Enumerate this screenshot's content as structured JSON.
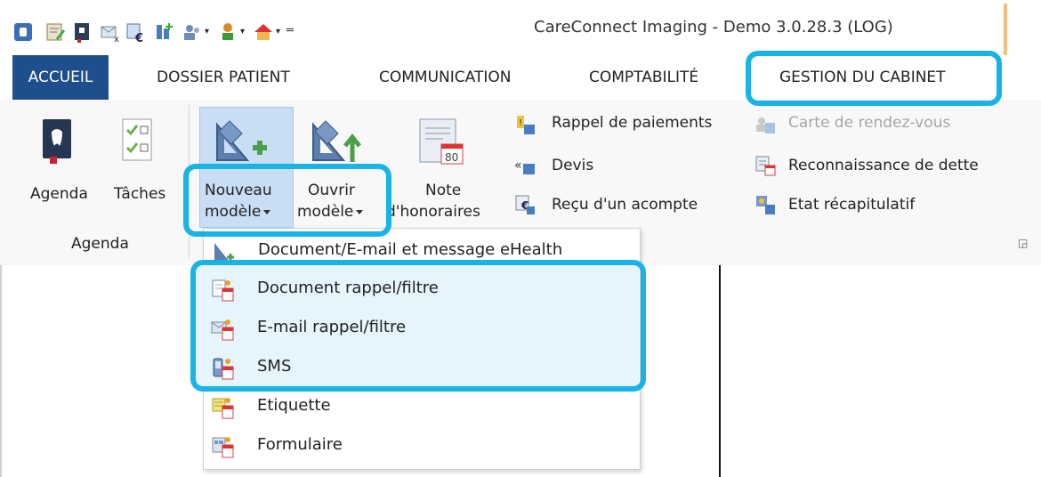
{
  "window": {
    "title": "CareConnect Imaging - Demo 3.0.28.3 (LOG)"
  },
  "quick_access": {
    "icons": [
      "app-icon",
      "patient-edit-icon",
      "agenda-book-icon",
      "mail-x-icon",
      "euro-invoice-icon",
      "print-icon",
      "users-icon",
      "stamp-icon",
      "home-folder-icon",
      "customize-icon"
    ]
  },
  "tabs": [
    {
      "label": "ACCUEIL"
    },
    {
      "label": "DOSSIER PATIENT"
    },
    {
      "label": "COMMUNICATION"
    },
    {
      "label": "COMPTABILITÉ"
    },
    {
      "label": "GESTION DU CABINET"
    }
  ],
  "ribbon": {
    "agenda_group": {
      "agenda_label": "Agenda",
      "taches_label": "Tâches",
      "group_label": "Agenda"
    },
    "models": {
      "new_line1": "Nouveau",
      "new_line2": "modèle",
      "open_line1": "Ouvrir",
      "open_line2": "modèle",
      "note_line1": "Note",
      "note_line2": "d'honoraires"
    },
    "small_buttons_col1": [
      {
        "label": "Rappel de paiements",
        "icon": "payment-reminder-icon"
      },
      {
        "label": "Devis",
        "icon": "quote-icon"
      },
      {
        "label": "Reçu d'un acompte",
        "icon": "deposit-receipt-icon"
      }
    ],
    "small_buttons_col2": [
      {
        "label": "Carte de rendez-vous",
        "icon": "appointment-card-icon",
        "disabled": true
      },
      {
        "label": "Reconnaissance de dette",
        "icon": "debt-acknowledgement-icon"
      },
      {
        "label": "Etat récapitulatif",
        "icon": "summary-statement-icon"
      }
    ]
  },
  "dropdown": {
    "items": [
      {
        "label": "Document/E-mail et message eHealth",
        "icon": "ehealth-document-icon"
      },
      {
        "label": "Document rappel/filtre",
        "icon": "document-filter-icon"
      },
      {
        "label": "E-mail rappel/filtre",
        "icon": "email-filter-icon"
      },
      {
        "label": "SMS",
        "icon": "sms-icon"
      },
      {
        "label": "Etiquette",
        "icon": "label-icon"
      },
      {
        "label": "Formulaire",
        "icon": "form-icon"
      }
    ]
  },
  "colors": {
    "active_tab": "#1e4e8c",
    "callout": "#1ab3e8",
    "highlight": "#e6f4fd",
    "ribbon_bg": "#f8f8f8"
  }
}
